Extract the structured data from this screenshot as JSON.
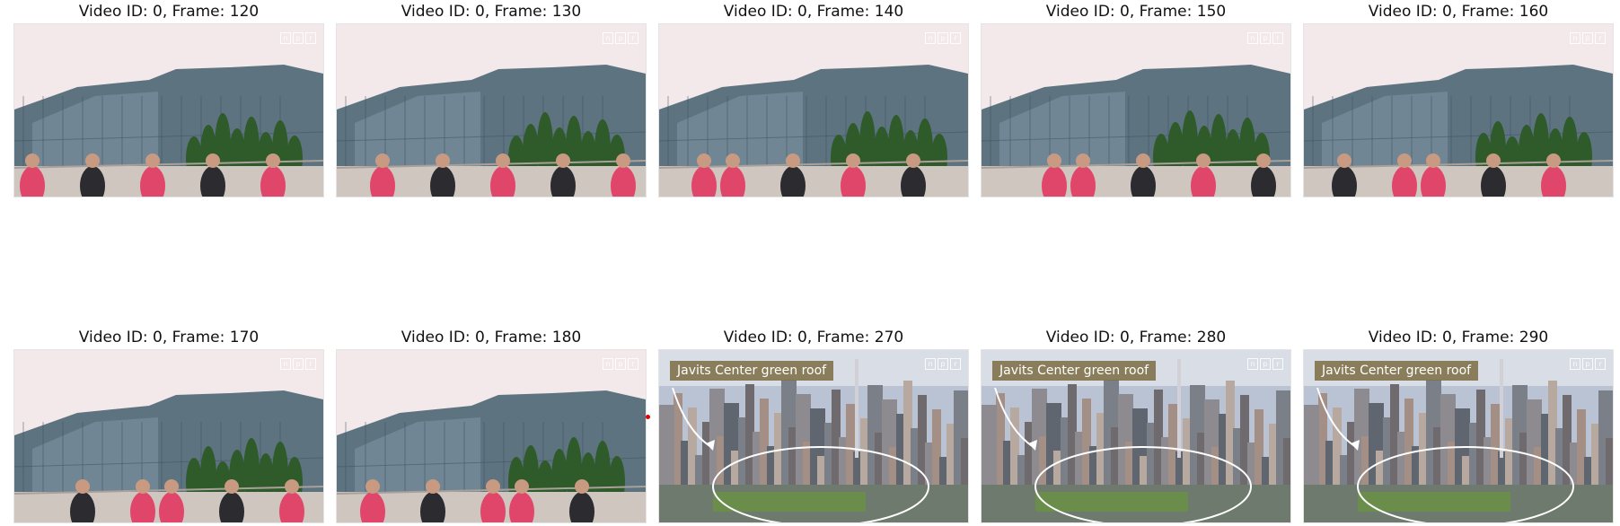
{
  "frames": [
    {
      "caption": "Video ID: 0, Frame: 120",
      "scene": "building",
      "overlay": ""
    },
    {
      "caption": "Video ID: 0, Frame: 130",
      "scene": "building",
      "overlay": ""
    },
    {
      "caption": "Video ID: 0, Frame: 140",
      "scene": "building",
      "overlay": ""
    },
    {
      "caption": "Video ID: 0, Frame: 150",
      "scene": "building",
      "overlay": ""
    },
    {
      "caption": "Video ID: 0, Frame: 160",
      "scene": "building",
      "overlay": ""
    },
    {
      "caption": "Video ID: 0, Frame: 170",
      "scene": "building",
      "overlay": ""
    },
    {
      "caption": "Video ID: 0, Frame: 180",
      "scene": "building",
      "overlay": ""
    },
    {
      "caption": "Video ID: 0, Frame: 270",
      "scene": "city",
      "overlay": "Javits Center green roof"
    },
    {
      "caption": "Video ID: 0, Frame: 280",
      "scene": "city",
      "overlay": "Javits Center green roof"
    },
    {
      "caption": "Video ID: 0, Frame: 290",
      "scene": "city",
      "overlay": "Javits Center green roof"
    }
  ],
  "watermark": {
    "letters": [
      "n",
      "p",
      "r"
    ]
  },
  "colors": {
    "sky": "#f3e9ea",
    "glass": "#5d7380",
    "tree": "#2f5a2a",
    "shirt_pink": "#e0456a",
    "label_bg": "#7d7048"
  }
}
